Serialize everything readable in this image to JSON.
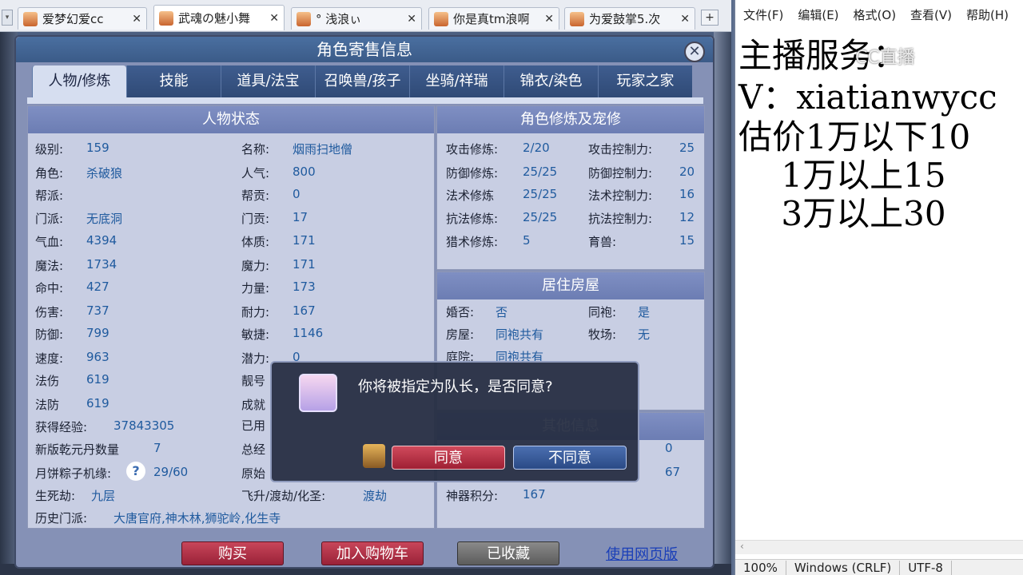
{
  "browser": {
    "tabs": [
      {
        "title": "爱梦幻爱cc"
      },
      {
        "title": "武魂の魅小舞"
      },
      {
        "title": "° 浅浪ぃ"
      },
      {
        "title": "你是真tm浪啊"
      },
      {
        "title": "为爱鼓掌5.次"
      }
    ],
    "close_glyph": "✕",
    "add_glyph": "+",
    "scroll_glyph": "▾"
  },
  "panel": {
    "title": "角色寄售信息",
    "close_glyph": "✕",
    "tabs": [
      "人物/修炼",
      "技能",
      "道具/法宝",
      "召唤兽/孩子",
      "坐骑/祥瑞",
      "锦衣/染色",
      "玩家之家"
    ],
    "active_tab": 0
  },
  "status": {
    "header": "人物状态",
    "left": [
      {
        "label": "级别:",
        "value": "159"
      },
      {
        "label": "角色:",
        "value": "杀破狼"
      },
      {
        "label": "帮派:",
        "value": ""
      },
      {
        "label": "门派:",
        "value": "无底洞"
      },
      {
        "label": "气血:",
        "value": "4394"
      },
      {
        "label": "魔法:",
        "value": "1734"
      },
      {
        "label": "命中:",
        "value": "427"
      },
      {
        "label": "伤害:",
        "value": "737"
      },
      {
        "label": "防御:",
        "value": "799"
      },
      {
        "label": "速度:",
        "value": "963"
      },
      {
        "label": "法伤",
        "value": "619"
      },
      {
        "label": "法防",
        "value": "619"
      }
    ],
    "right": [
      {
        "label": "名称:",
        "value": "烟雨扫地僧"
      },
      {
        "label": "人气:",
        "value": "800"
      },
      {
        "label": "帮贡:",
        "value": "0"
      },
      {
        "label": "门贡:",
        "value": "17"
      },
      {
        "label": "体质:",
        "value": "171"
      },
      {
        "label": "魔力:",
        "value": "171"
      },
      {
        "label": "力量:",
        "value": "173"
      },
      {
        "label": "耐力:",
        "value": "167"
      },
      {
        "label": "敏捷:",
        "value": "1146"
      },
      {
        "label": "潜力:",
        "value": "0"
      },
      {
        "label": "靓号",
        "value": ""
      },
      {
        "label": "成就",
        "value": ""
      },
      {
        "label": "已用",
        "value": ""
      },
      {
        "label": "总经",
        "value": ""
      },
      {
        "label": "原始",
        "value": ""
      }
    ],
    "exp_label": "获得经验:",
    "exp_value": "37843305",
    "qianyuan_label": "新版乾元丹数量",
    "qianyuan_value": "7",
    "mooncake_label": "月饼粽子机缘:",
    "mooncake_help": "?",
    "mooncake_value": "29/60",
    "shengsi_label": "生死劫:",
    "shengsi_value": "九层",
    "feisheng_label": "飞升/渡劫/化圣:",
    "feisheng_value": "渡劫",
    "history_label": "历史门派:",
    "history_value": "大唐官府,神木林,狮驼岭,化生寺"
  },
  "cultivation": {
    "header": "角色修炼及宠修",
    "left": [
      {
        "label": "攻击修炼:",
        "value": "2/20"
      },
      {
        "label": "防御修炼:",
        "value": "25/25"
      },
      {
        "label": "法术修炼",
        "value": "25/25"
      },
      {
        "label": "抗法修炼:",
        "value": "25/25"
      },
      {
        "label": "猎术修炼:",
        "value": "5"
      }
    ],
    "right": [
      {
        "label": "攻击控制力:",
        "value": "25"
      },
      {
        "label": "防御控制力:",
        "value": "20"
      },
      {
        "label": "法术控制力:",
        "value": "16"
      },
      {
        "label": "抗法控制力:",
        "value": "12"
      },
      {
        "label": "育兽:",
        "value": "15"
      }
    ]
  },
  "housing": {
    "header": "居住房屋",
    "rows": [
      {
        "label": "婚否:",
        "value": "否",
        "label2": "同袍:",
        "value2": "是"
      },
      {
        "label": "房屋:",
        "value": "同袍共有",
        "label2": "牧场:",
        "value2": "无"
      },
      {
        "label": "庭院:",
        "value": "同袍共有",
        "label2": "",
        "value2": ""
      }
    ]
  },
  "other": {
    "header": "其他信息",
    "rows": [
      {
        "label": "",
        "value": "0"
      },
      {
        "label": "",
        "value": "67"
      },
      {
        "label": "神器积分:",
        "value": "167"
      }
    ]
  },
  "actions": {
    "buy": "购买",
    "add_cart": "加入购物车",
    "favorited": "已收藏",
    "web_link": "使用网页版"
  },
  "dialog": {
    "message": "你将被指定为队长，是否同意?",
    "agree": "同意",
    "disagree": "不同意"
  },
  "notepad": {
    "menu": [
      "文件(F)",
      "编辑(E)",
      "格式(O)",
      "查看(V)",
      "帮助(H)"
    ],
    "lines": [
      "主播服务：",
      "V：xiatianwycc",
      "估价1万以下10",
      "    1万以上15",
      "    3万以上30"
    ],
    "watermark": "CC直播",
    "status": [
      "100%",
      "Windows (CRLF)",
      "UTF-8"
    ]
  },
  "colors": {
    "label": "#1c2233",
    "value": "#1f5a9e",
    "header": "#7384b8",
    "buy_btn": "#b0344a",
    "favorited_btn": "#6e6e6e"
  }
}
